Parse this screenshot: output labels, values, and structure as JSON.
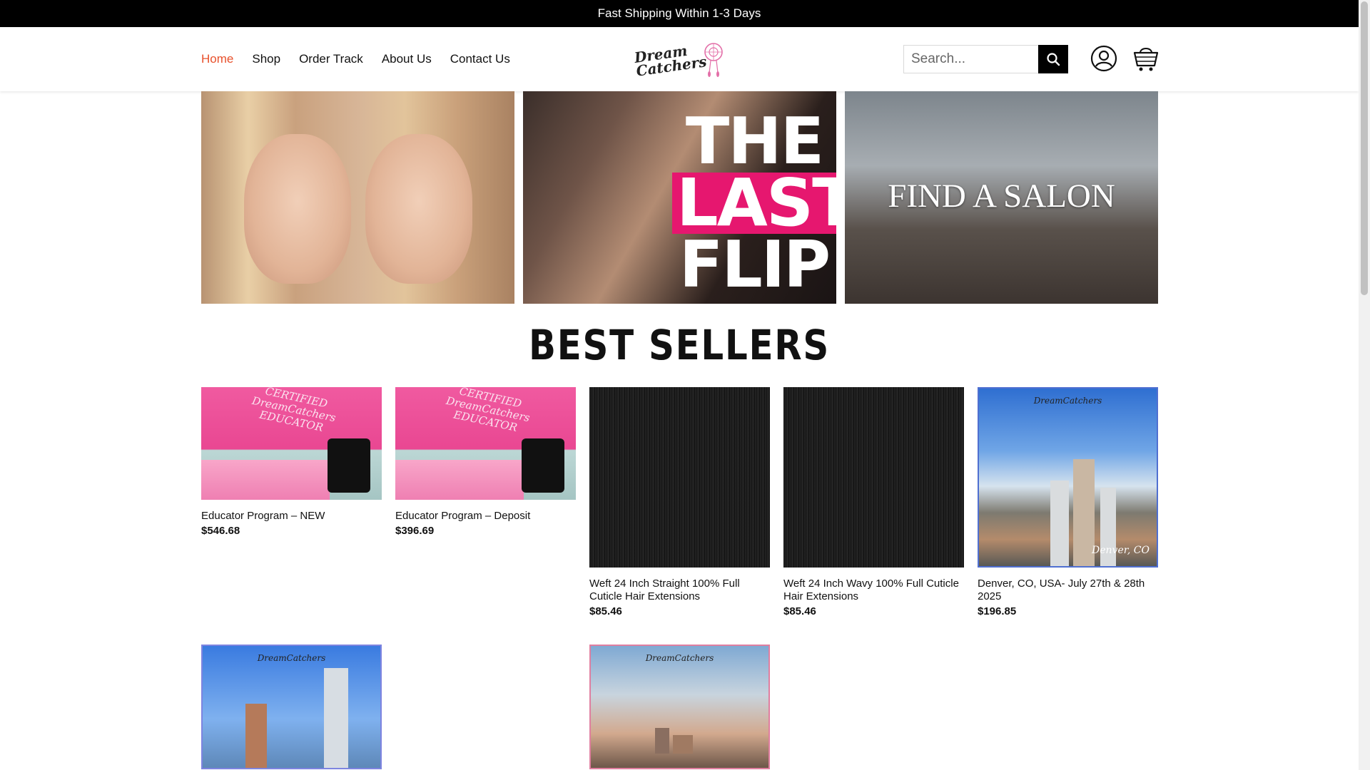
{
  "topbar": {
    "text": "Fast Shipping Within 1-3 Days"
  },
  "nav": {
    "items": [
      {
        "label": "Home",
        "active": true
      },
      {
        "label": "Shop"
      },
      {
        "label": "Order Track"
      },
      {
        "label": "About Us"
      },
      {
        "label": "Contact Us"
      }
    ]
  },
  "logo": {
    "line1": "Dream",
    "line2": "Catchers"
  },
  "search": {
    "placeholder": "Search..."
  },
  "icons": {
    "search": "search-icon",
    "account": "user-circle-icon",
    "cart": "shopping-cart-icon"
  },
  "banner": {
    "panels": [
      {
        "name": "hair-models"
      },
      {
        "name": "the-last-flip",
        "line1": "THE",
        "line2": "LAST",
        "line3": "FLIP"
      },
      {
        "name": "find-a-salon",
        "text": "FIND A SALON"
      }
    ]
  },
  "best_sellers": {
    "title": "BEST SELLERS",
    "products": [
      {
        "name": "Educator Program – NEW",
        "price": "$546.68",
        "image_text": [
          "CERTIFIED",
          "DreamCatchers",
          "EDUCATOR"
        ]
      },
      {
        "name": "Educator Program – Deposit",
        "price": "$396.69",
        "image_text": [
          "CERTIFIED",
          "DreamCatchers",
          "EDUCATOR"
        ]
      },
      {
        "name": "Weft 24 Inch Straight 100% Full Cuticle Hair Extensions",
        "price": "$85.46"
      },
      {
        "name": "Weft 24 Inch Wavy 100% Full Cuticle Hair Extensions",
        "price": "$85.46"
      },
      {
        "name": "Denver, CO, USA- July 27th & 28th 2025",
        "price": "$196.85",
        "image_caption": "Denver, CO",
        "image_logo": "DreamCatchers"
      }
    ],
    "row2": [
      {
        "image_logo": "DreamCatchers"
      },
      {
        "image_logo": "DreamCatchers"
      }
    ]
  },
  "colors": {
    "accent": "#e8502b",
    "topbar": "#000000",
    "pink": "#e6176f"
  }
}
